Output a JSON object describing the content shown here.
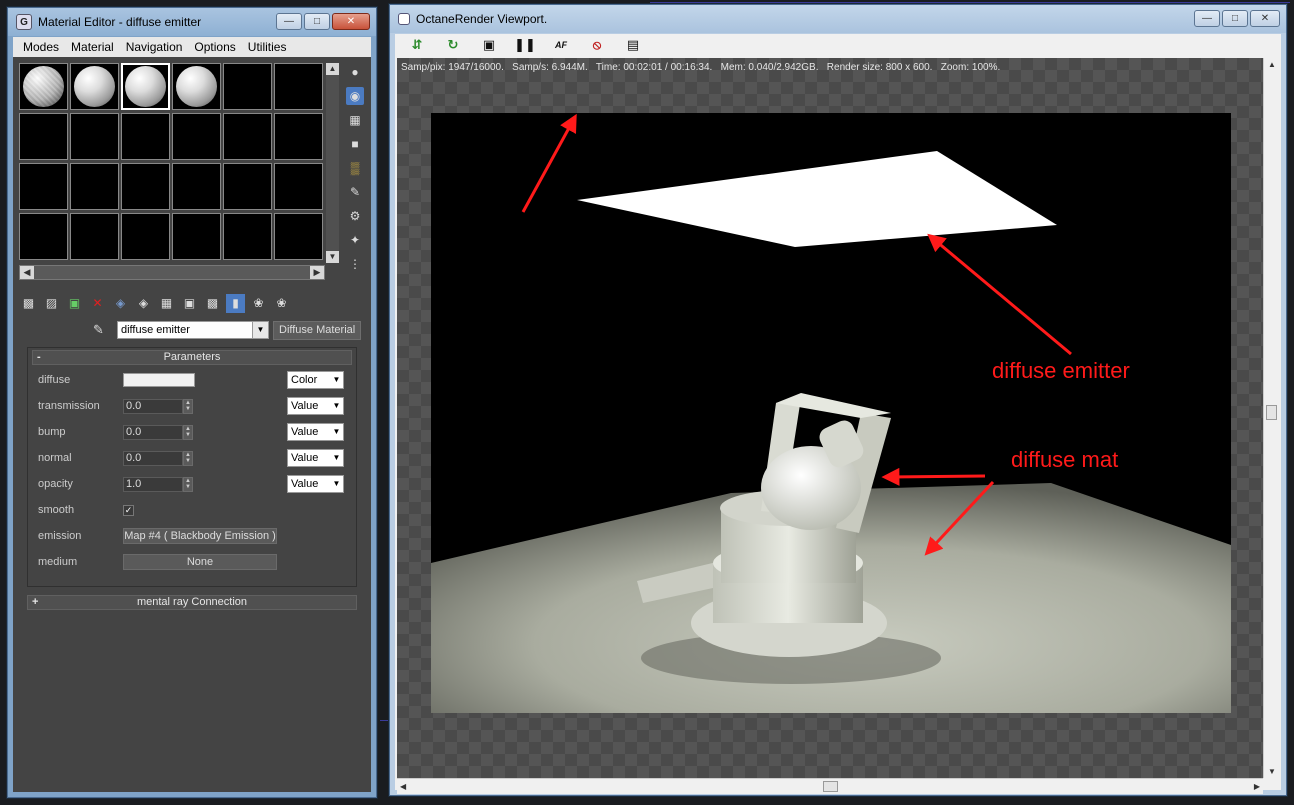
{
  "material_editor": {
    "app_icon": "3ds-max-icon",
    "title": "Material Editor - diffuse emitter",
    "menu": [
      "Modes",
      "Material",
      "Navigation",
      "Options",
      "Utilities"
    ],
    "material_name": "diffuse emitter",
    "material_type": "Diffuse Material",
    "params_title": "Parameters",
    "params_toggle": "-",
    "params": {
      "diffuse": {
        "label": "diffuse",
        "mode": "Color"
      },
      "transmission": {
        "label": "transmission",
        "value": "0.0",
        "mode": "Value"
      },
      "bump": {
        "label": "bump",
        "value": "0.0",
        "mode": "Value"
      },
      "normal": {
        "label": "normal",
        "value": "0.0",
        "mode": "Value"
      },
      "opacity": {
        "label": "opacity",
        "value": "1.0",
        "mode": "Value"
      },
      "smooth": {
        "label": "smooth",
        "checked": true
      },
      "emission": {
        "label": "emission",
        "map": "Map #4 ( Blackbody Emission )"
      },
      "medium": {
        "label": "medium",
        "map": "None"
      }
    },
    "mental_ray_title": "mental ray Connection",
    "mental_ray_toggle": "+"
  },
  "octane": {
    "title": "OctaneRender Viewport.",
    "stats": "Samp/pix: 1947/16000.   Samp/s: 6.944M.   Time: 00:02:01 / 00:16:34.   Mem: 0.040/2.942GB.   Render size: 800 x 600.   Zoom: 100%.",
    "toolbar_icons": [
      "export-icon",
      "restart-icon",
      "lock-icon",
      "pause-icon",
      "af-icon",
      "no-render-icon",
      "display-icon"
    ],
    "af_label": "AF"
  },
  "annotations": {
    "emitter": "diffuse emitter",
    "mat": "diffuse mat",
    "color": "#ff1a1a"
  }
}
